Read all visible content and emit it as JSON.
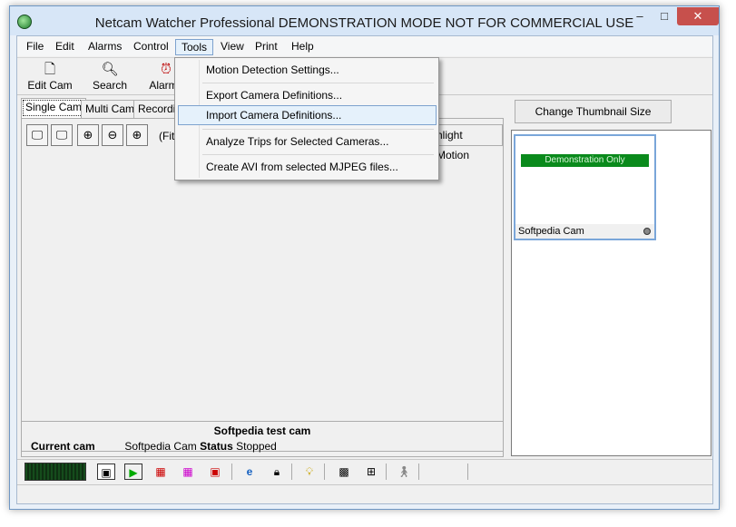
{
  "window": {
    "title": "Netcam Watcher Professional DEMONSTRATION MODE NOT FOR COMMERCIAL USE"
  },
  "controls": {
    "minimize": "–",
    "maximize": "□",
    "close": "✕"
  },
  "menubar": [
    "File",
    "Edit",
    "Alarms",
    "Control",
    "Tools",
    "View",
    "Print",
    "Help"
  ],
  "toolbar": {
    "edit_cam": "Edit Cam",
    "search": "Search",
    "alarms": "Alarms"
  },
  "tabs": [
    "Single Cam",
    "Multi Cam",
    "Recordin"
  ],
  "view": {
    "fit_text": "(Fit",
    "highlight_motion": "hlight Motion"
  },
  "thumbnail": {
    "change_size_button": "Change Thumbnail Size",
    "demo_bar": "Demonstration Only",
    "cam_label": "Softpedia Cam"
  },
  "status": {
    "title": "Softpedia test cam",
    "current_cam_label": "Current cam",
    "current_cam_value": "Softpedia Cam",
    "status_label": "Status",
    "status_value": "Stopped"
  },
  "tools_menu": {
    "items": [
      "Motion Detection Settings...",
      "Export Camera Definitions...",
      "Import Camera Definitions...",
      "Analyze Trips for Selected Cameras...",
      "Create AVI from selected MJPEG files..."
    ]
  }
}
